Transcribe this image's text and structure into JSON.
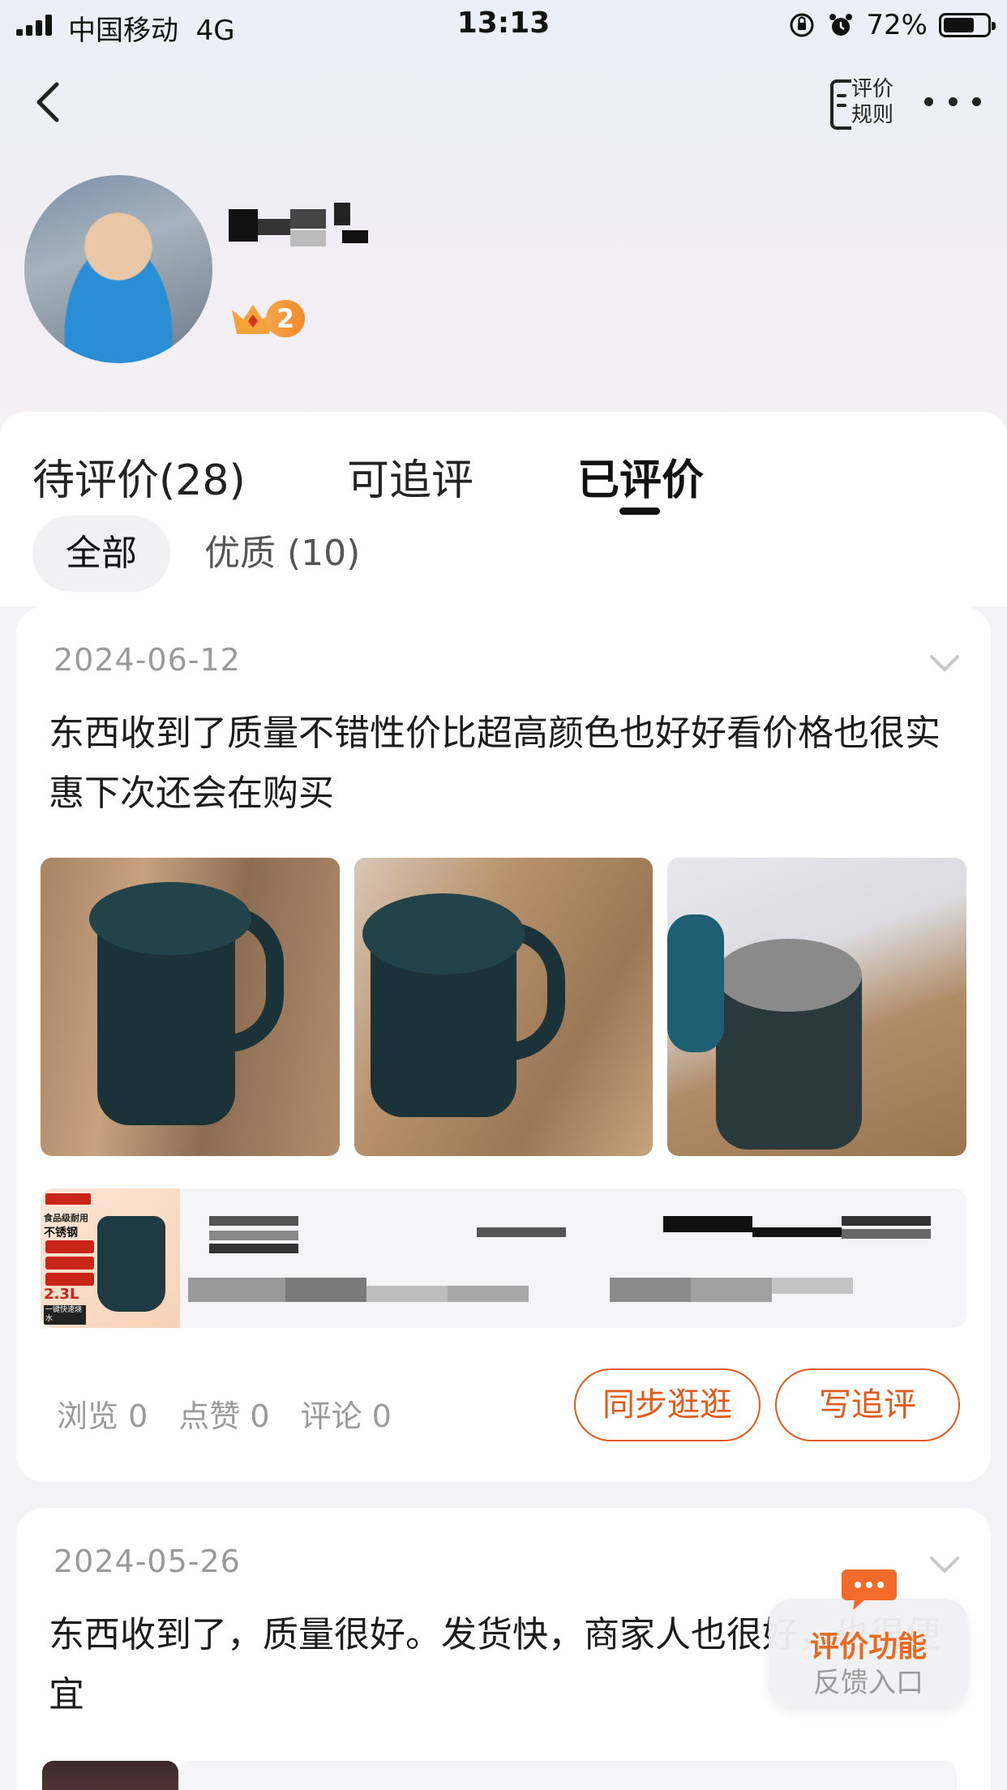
{
  "status_bar": {
    "carrier": "中国移动",
    "network": "4G",
    "time": "13:13",
    "battery": "72%",
    "battery_level": 0.72
  },
  "nav": {
    "back_icon": "chevron-left-icon",
    "rules_label_line1": "评价",
    "rules_label_line2": "规则",
    "more_icon": "more-dots-icon"
  },
  "profile": {
    "level": "2",
    "level_icon": "crown-icon"
  },
  "tabs": [
    {
      "label": "待评价(28)"
    },
    {
      "label": "可追评"
    },
    {
      "label": "已评价"
    }
  ],
  "active_tab": "已评价",
  "filters": [
    {
      "label": "全部"
    },
    {
      "label": "优质 (10)"
    }
  ],
  "reviews": [
    {
      "date": "2024-06-12",
      "text": "东西收到了质量不错性价比超高颜色也好好看价格也很实惠下次还会在购买",
      "photo_count": 3,
      "product_thumb_text": {
        "line1": "食品级耐用",
        "line2": "不锈钢",
        "capacity": "2.3L",
        "badge": "一键快速烧水"
      },
      "stats": {
        "views_label": "浏览",
        "views": "0",
        "likes_label": "点赞",
        "likes": "0",
        "comments_label": "评论",
        "comments": "0"
      },
      "actions": {
        "sync_label": "同步逛逛",
        "follow_label": "写追评"
      }
    },
    {
      "date": "2024-05-26",
      "text": "东西收到了，质量很好。发货快，商家人也很好，也很便宜"
    }
  ],
  "feedback": {
    "line1": "评价功能",
    "line2": "反馈入口",
    "icon": "chat-bubble-icon"
  },
  "colors": {
    "accent": "#e25a1c",
    "feedback_accent": "#e66a22",
    "header_bg": "#eceef8"
  }
}
